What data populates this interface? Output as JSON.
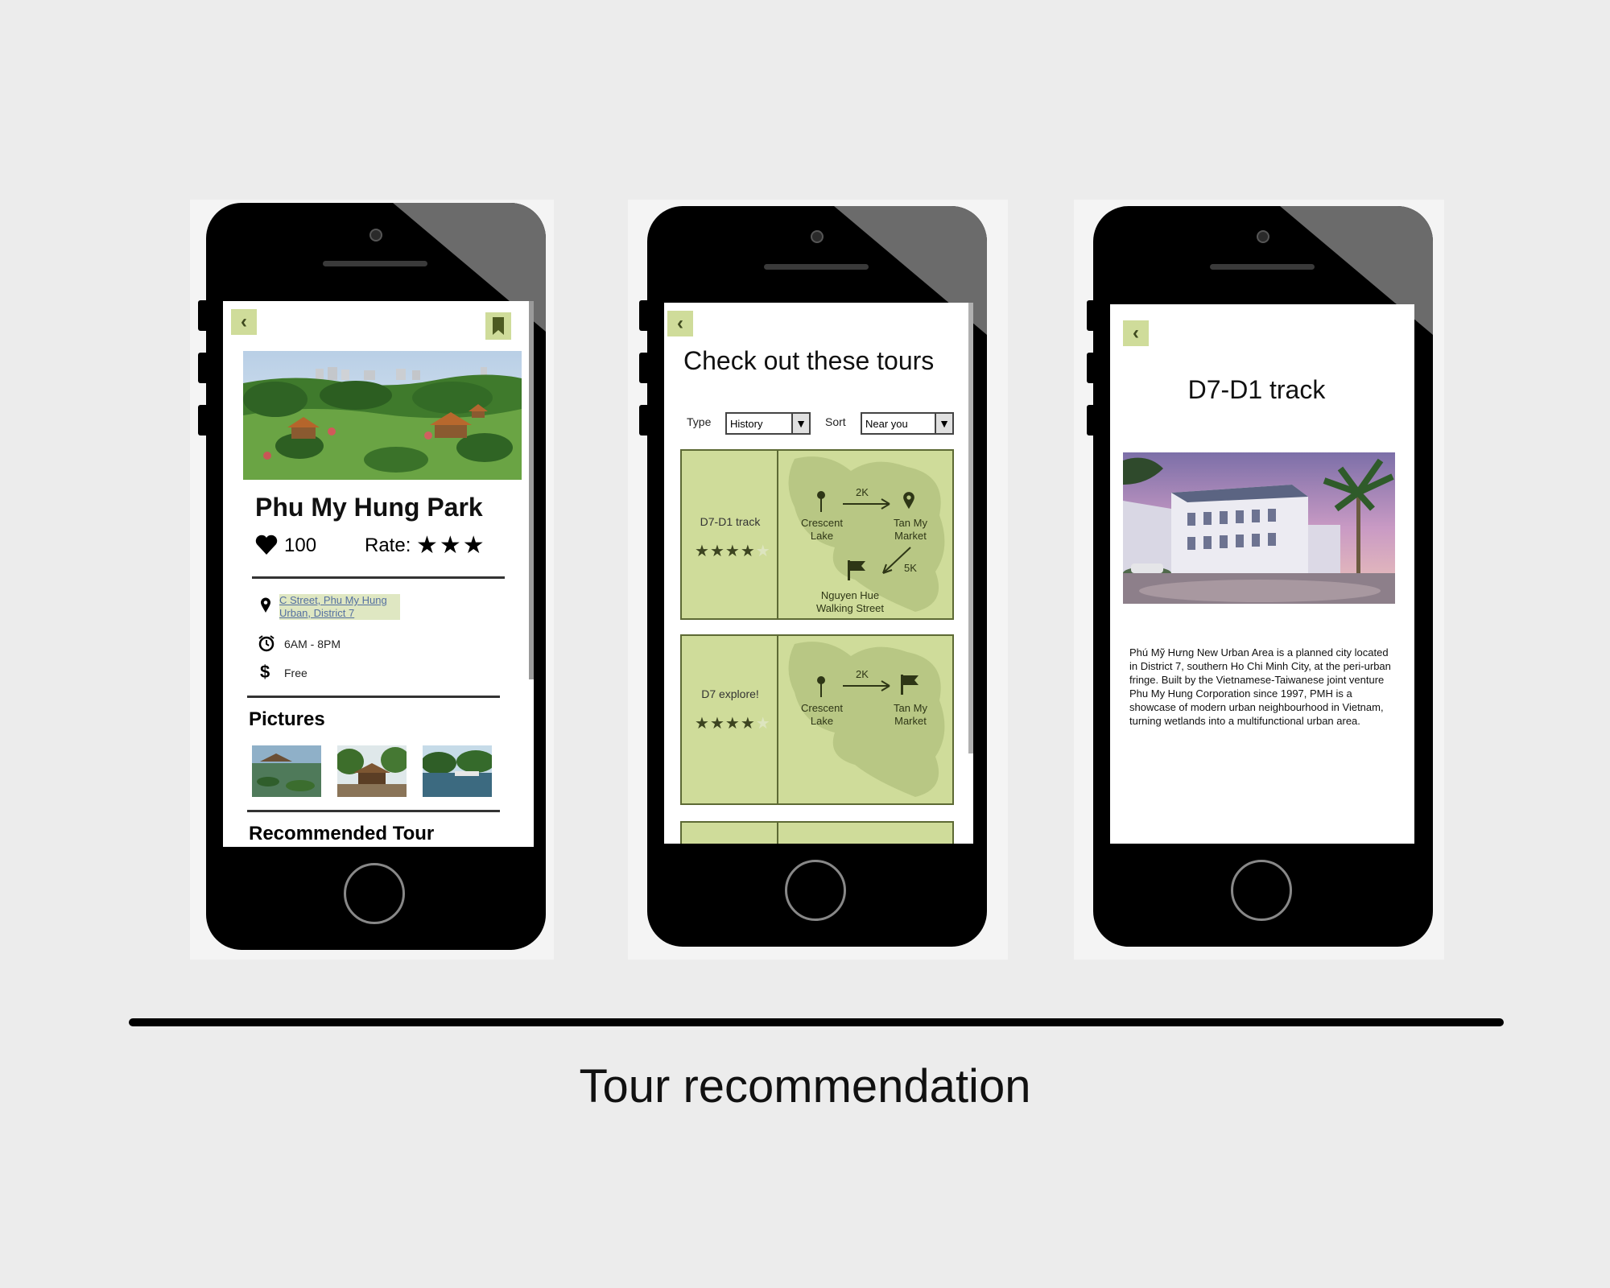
{
  "phone1": {
    "title": "Phu My Hung Park",
    "likes": "100",
    "rate_label": "Rate:",
    "rate_stars": "★★★",
    "address": "C Street, Phu My Hung Urban, District 7",
    "hours": "6AM - 8PM",
    "price": "Free",
    "pictures_heading": "Pictures",
    "recommended_heading": "Recommended Tour"
  },
  "phone2": {
    "title": "Check out these tours",
    "type_label": "Type",
    "type_value": "History",
    "sort_label": "Sort",
    "sort_value": "Near you",
    "tours": [
      {
        "name": "D7-D1 track",
        "rating": 4,
        "stars": "★★★★★",
        "map": {
          "a": "Crescent Lake",
          "b": "Tan My Market",
          "c": "Nguyen Hue Walking Street",
          "d1": "2K",
          "d2": "5K"
        }
      },
      {
        "name": "D7 explore!",
        "rating": 4,
        "stars": "★★★★★",
        "map": {
          "a": "Crescent Lake",
          "b": "Tan My Market",
          "d1": "2K"
        }
      }
    ]
  },
  "phone3": {
    "title": "D7-D1 track",
    "description": "Phú Mỹ Hưng New Urban Area is a planned city located in District 7, southern Ho Chi Minh City, at the peri-urban fringe. Built by the Vietnamese-Taiwanese joint venture Phu My Hung Corporation since 1997, PMH is a showcase of modern urban neighbourhood in Vietnam, turning wetlands into a multifunctional urban area."
  },
  "caption": "Tour recommendation",
  "colors": {
    "accent": "#cfdc9a",
    "accent_dark": "#5d6a34",
    "background": "#ececec"
  }
}
